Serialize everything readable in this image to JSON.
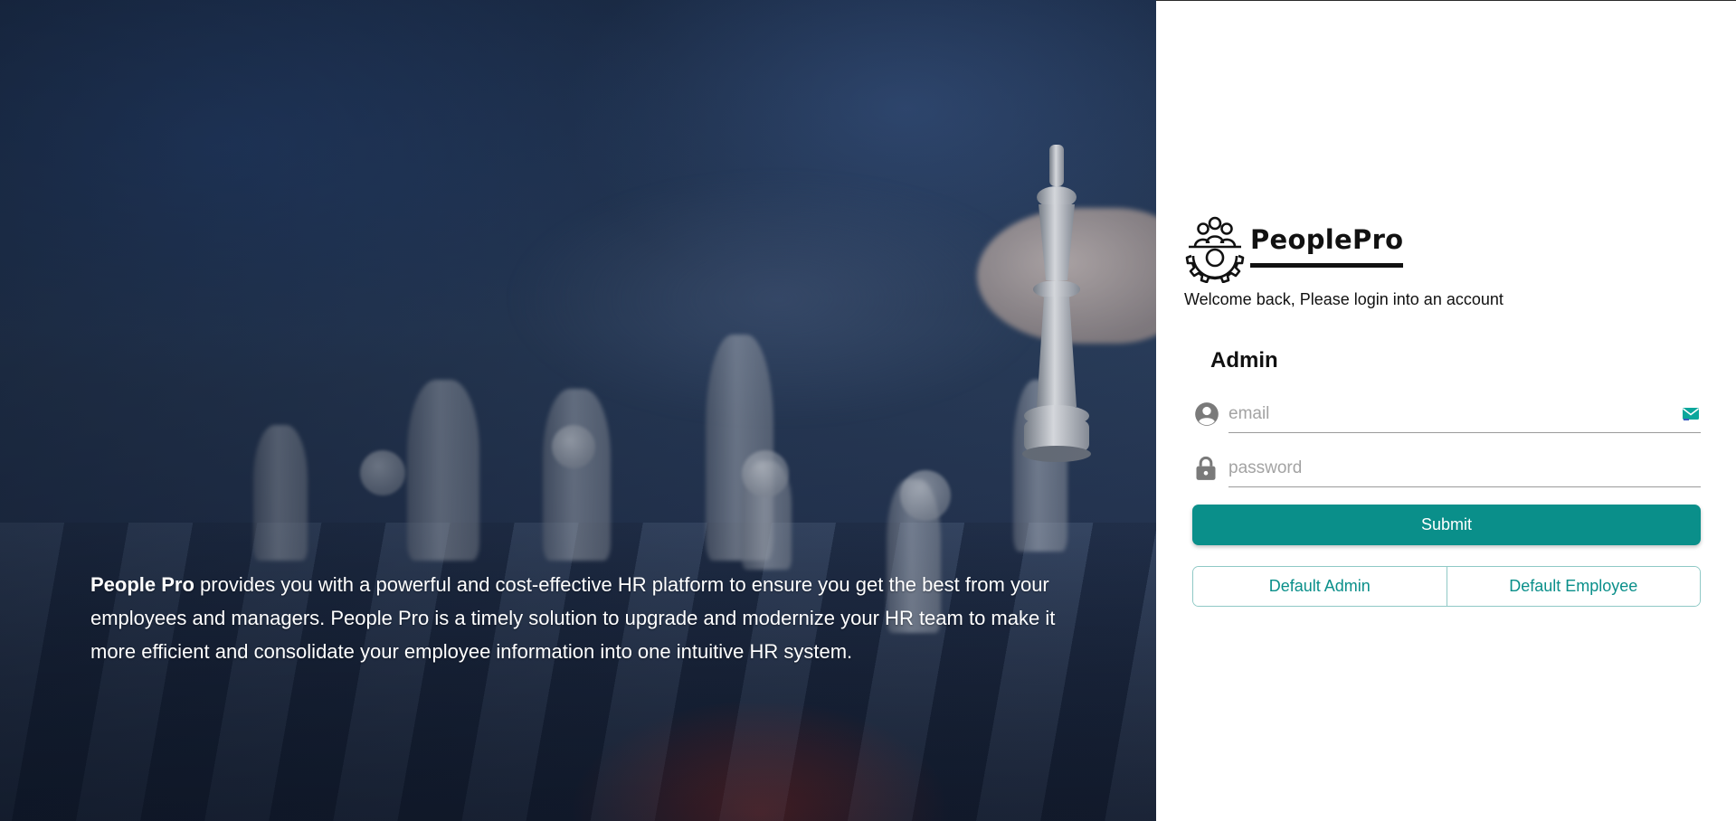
{
  "hero": {
    "brand_bold": "People Pro",
    "description": " provides you with a powerful and cost-effective HR platform to ensure you get the best from your employees and managers. People Pro is a timely solution to upgrade and modernize your HR team to make it more efficient and consolidate your employee information into one intuitive HR system."
  },
  "logo": {
    "text": "PeoplePro",
    "icon": "people-gear-icon"
  },
  "login": {
    "welcome": "Welcome back, Please login into an account",
    "role_title": "Admin",
    "email": {
      "placeholder": "email",
      "value": "",
      "icon": "user-circle-icon",
      "badge_icon": "mail-icon"
    },
    "password": {
      "placeholder": "password",
      "value": "",
      "icon": "lock-icon"
    },
    "submit_label": "Submit",
    "default_admin_label": "Default Admin",
    "default_employee_label": "Default Employee"
  },
  "colors": {
    "accent": "#0a8f8a",
    "accent_border": "#8fc9c6",
    "text": "#111111"
  }
}
